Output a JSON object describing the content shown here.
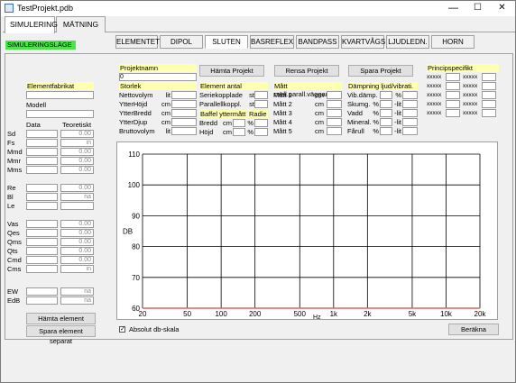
{
  "window": {
    "title": "TestProjekt.pdb",
    "minimize": "—",
    "maximize": "☐",
    "close": "✕"
  },
  "main_tabs": [
    "SIMULERING",
    "MÄTNING"
  ],
  "mode_label": "SIMULERINGSLÄGE",
  "sub_tabs": [
    "ELEMENTET",
    "DIPOL",
    "SLUTEN",
    "BASREFLEX",
    "BANDPASS",
    "KVARTVÅGS",
    "LJUDLEDN.",
    "HORN"
  ],
  "element": {
    "fabrikat_label": "Elementfabrikat",
    "modell_label": "Modell",
    "data_header": "Data",
    "teoretiskt_header": "Teoretiskt",
    "params": [
      {
        "label": "Sd",
        "value": "0.00"
      },
      {
        "label": "Fs",
        "value": "in"
      },
      {
        "label": "Mmd",
        "value": "0.00"
      },
      {
        "label": "Mmr",
        "value": "0.00"
      },
      {
        "label": "Mms",
        "value": "0.00"
      },
      {
        "label": "Re",
        "value": "0.00"
      },
      {
        "label": "Bl",
        "value": "na"
      },
      {
        "label": "Le",
        "value": ""
      },
      {
        "label": "Vas",
        "value": "0.00"
      },
      {
        "label": "Qes",
        "value": "0.00"
      },
      {
        "label": "Qms",
        "value": "0.00"
      },
      {
        "label": "Qts",
        "value": "0.00"
      },
      {
        "label": "Cmd",
        "value": "0.00"
      },
      {
        "label": "Cms",
        "value": "in"
      },
      {
        "label": "EW",
        "value": "na"
      },
      {
        "label": "EdB",
        "value": "na"
      }
    ],
    "hamta_btn": "Hämta element separat",
    "spara_btn": "Spara element separat"
  },
  "project": {
    "name_label": "Projektnamn",
    "name_value": "0",
    "hamta": "Hämta Projekt",
    "rensa": "Rensa Projekt",
    "spara": "Spara Projekt"
  },
  "storlek": {
    "header": "Storlek",
    "rows": [
      {
        "label": "Nettovolym",
        "unit": "lit"
      },
      {
        "label": "YtterHöjd",
        "unit": "cm"
      },
      {
        "label": "YtterBredd",
        "unit": "cm"
      },
      {
        "label": "YtterDjup",
        "unit": "cm"
      },
      {
        "label": "Bruttovolym",
        "unit": "lit"
      }
    ]
  },
  "element_antal": {
    "header": "Element antal",
    "rows": [
      {
        "label": "Seriekopplade",
        "unit": "st"
      },
      {
        "label": "Parallellkoppl.",
        "unit": "st"
      }
    ],
    "baffel_header": "Baffel yttermått",
    "radie_header": "Radie",
    "baffel_rows": [
      {
        "label": "Bredd",
        "unit": "cm",
        "unit2": "%"
      },
      {
        "label": "Höjd",
        "unit": "cm",
        "unit2": "%"
      }
    ]
  },
  "matt": {
    "header": "Mått mell.parall.väggar",
    "rows": [
      {
        "label": "Mått 1",
        "unit": "cm"
      },
      {
        "label": "Mått 2",
        "unit": "cm"
      },
      {
        "label": "Mått 3",
        "unit": "cm"
      },
      {
        "label": "Mått 4",
        "unit": "cm"
      },
      {
        "label": "Mått 5",
        "unit": "cm"
      }
    ]
  },
  "dampning": {
    "header": "Dämpning ljud/vibrati.",
    "rows": [
      {
        "label": "Vib.dämp.",
        "unit": "",
        "unit2": "%"
      },
      {
        "label": "Skumg.",
        "unit": "%",
        "unit2": "-lit"
      },
      {
        "label": "Vadd",
        "unit": "%",
        "unit2": "-lit"
      },
      {
        "label": "Mineral.",
        "unit": "%",
        "unit2": "-lit"
      },
      {
        "label": "Fårull",
        "unit": "%",
        "unit2": "-lit"
      }
    ]
  },
  "princip": {
    "header": "Principspecifikt",
    "cells": [
      "xxxxx",
      "xxxxx",
      "xxxxx",
      "xxxxx",
      "xxxxx",
      "xxxxx",
      "xxxxx",
      "xxxxx",
      "xxxxx",
      "xxxxx"
    ]
  },
  "absolut_label": "Absolut db-skala",
  "absolut_checked": "✓",
  "berakna": "Beräkna",
  "chart_data": {
    "type": "line",
    "xlabel": "Hz",
    "ylabel": "DB",
    "x_ticks": [
      "20",
      "50",
      "100",
      "200",
      "500",
      "1k",
      "2k",
      "5k",
      "10k",
      "20k"
    ],
    "x_tick_values": [
      20,
      50,
      100,
      200,
      500,
      1000,
      2000,
      5000,
      10000,
      20000
    ],
    "x_scale": "log",
    "y_ticks": [
      "60",
      "70",
      "80",
      "90",
      "100",
      "110"
    ],
    "ylim": [
      60,
      110
    ],
    "xlim": [
      20,
      20000
    ],
    "grid": true,
    "series": [
      {
        "x": [
          20,
          20000
        ],
        "y": [
          60,
          60
        ],
        "color": "#e06060"
      }
    ]
  },
  "checkmark_tab": "✓"
}
